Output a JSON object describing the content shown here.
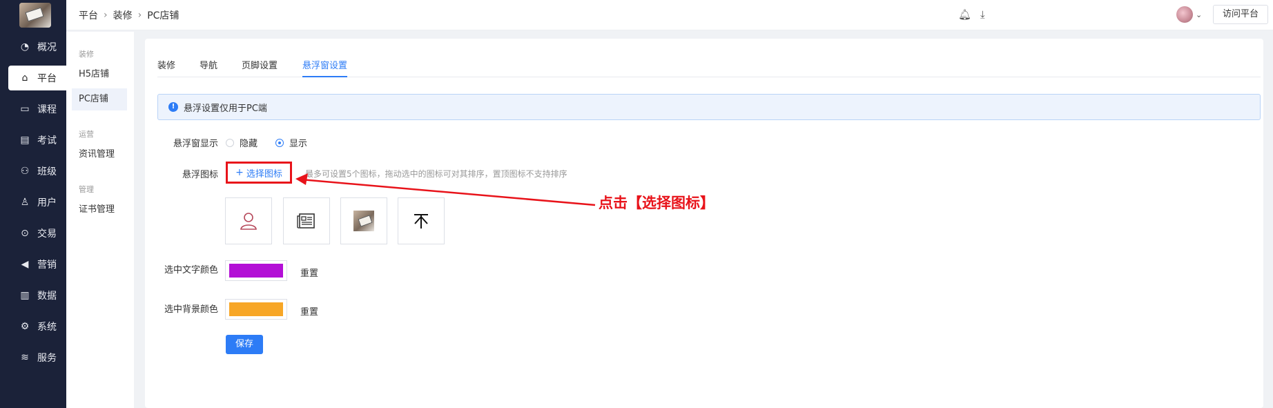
{
  "sidebar": {
    "items": [
      {
        "icon": "clock-icon",
        "glyph": "◔",
        "label": "概况"
      },
      {
        "icon": "store-icon",
        "glyph": "⌂",
        "label": "平台"
      },
      {
        "icon": "book-icon",
        "glyph": "▭",
        "label": "课程"
      },
      {
        "icon": "exam-icon",
        "glyph": "▤",
        "label": "考试"
      },
      {
        "icon": "class-icon",
        "glyph": "⚇",
        "label": "班级"
      },
      {
        "icon": "user-icon",
        "glyph": "♙",
        "label": "用户"
      },
      {
        "icon": "trade-icon",
        "glyph": "⊙",
        "label": "交易"
      },
      {
        "icon": "marketing-icon",
        "glyph": "◀",
        "label": "营销"
      },
      {
        "icon": "chart-icon",
        "glyph": "▥",
        "label": "数据"
      },
      {
        "icon": "settings-icon",
        "glyph": "⚙",
        "label": "系统"
      },
      {
        "icon": "service-icon",
        "glyph": "≋",
        "label": "服务"
      }
    ],
    "active_index": 1
  },
  "subnav": {
    "groups": [
      {
        "title": "装修",
        "items": [
          "H5店铺",
          "PC店铺"
        ]
      },
      {
        "title": "运营",
        "items": [
          "资讯管理"
        ]
      },
      {
        "title": "管理",
        "items": [
          "证书管理"
        ]
      }
    ]
  },
  "header": {
    "breadcrumb": [
      "平台",
      "装修",
      "PC店铺"
    ],
    "visit_label": "访问平台"
  },
  "tabs": [
    "装修",
    "导航",
    "页脚设置",
    "悬浮窗设置"
  ],
  "active_tab": 3,
  "alert": {
    "text": "悬浮设置仅用于PC端"
  },
  "form": {
    "display_label": "悬浮窗显示",
    "radio_hide": "隐藏",
    "radio_show": "显示",
    "display_value": "显示",
    "icon_label": "悬浮图标",
    "select_icon_label": "选择图标",
    "hint": "最多可设置5个图标，拖动选中的图标可对其排序，置顶图标不支持排序",
    "icons": [
      "user-outline-icon",
      "news-icon",
      "photo-thumbnail",
      "to-top-icon"
    ],
    "text_color_label": "选中文字颜色",
    "text_color": "#b30fd6",
    "bg_color_label": "选中背景颜色",
    "bg_color": "#f7a626",
    "reset_label": "重置",
    "save_label": "保存"
  },
  "annotation": {
    "text": "点击【选择图标】",
    "color": "#e8131a"
  }
}
